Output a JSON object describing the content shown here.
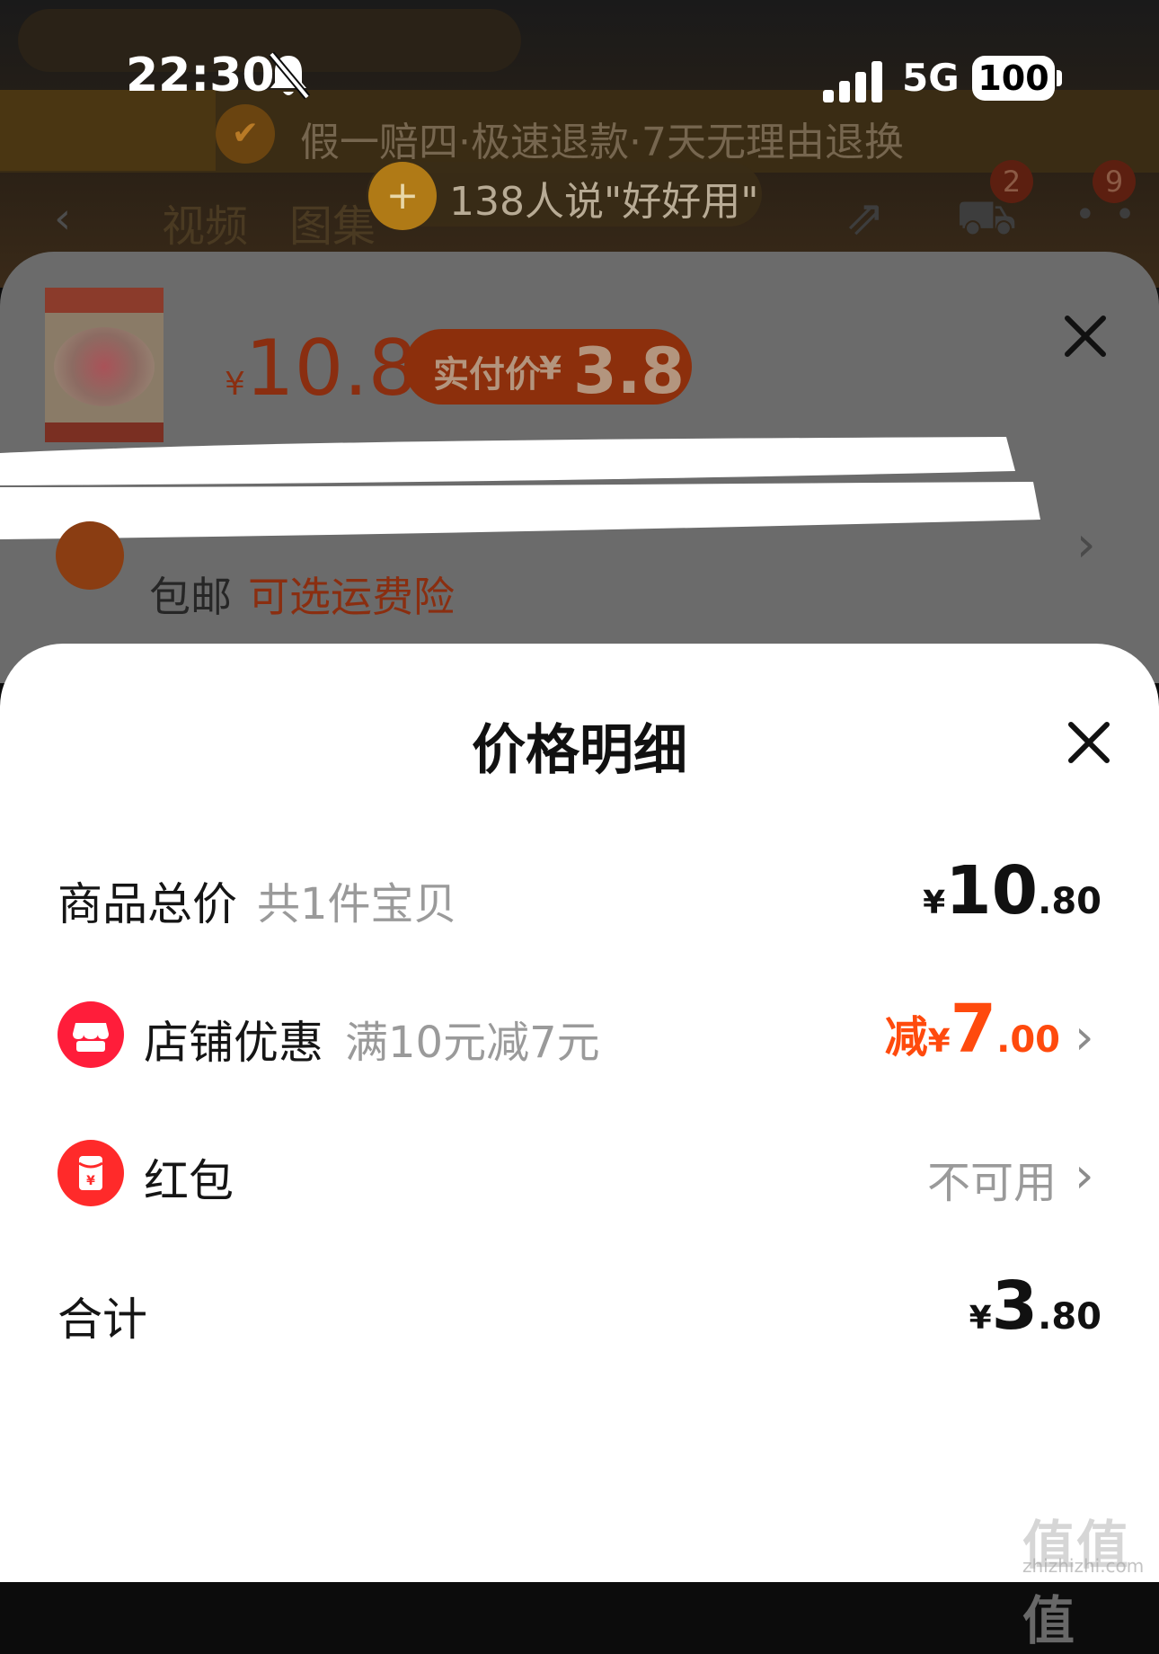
{
  "status_bar": {
    "time": "22:30",
    "network": "5G",
    "battery": "100"
  },
  "background": {
    "guarantee_text": "假一赔四·极速退款·7天无理由退换",
    "praise_text": "138人说\"好好用\"",
    "tabs": [
      "视频",
      "图集"
    ],
    "cart_badge": "2",
    "more_badge": "9"
  },
  "sku_sheet": {
    "price_currency": "¥",
    "price_value": "10.8",
    "pay_label": "实付价",
    "pay_currency": "¥",
    "pay_value": "3.8",
    "shipping_free": "包邮",
    "shipping_insurance": "可选运费险"
  },
  "price_detail": {
    "title": "价格明细",
    "rows": [
      {
        "label": "商品总价",
        "sub": "共1件宝贝",
        "currency": "¥",
        "integer": "10",
        "decimal": ".80"
      },
      {
        "label": "店铺优惠",
        "sub": "满10元减7元",
        "prefix": "减",
        "currency": "¥",
        "integer": "7",
        "decimal": ".00"
      },
      {
        "label": "红包",
        "status": "不可用"
      },
      {
        "label": "合计",
        "currency": "¥",
        "integer": "3",
        "decimal": ".80"
      }
    ]
  },
  "watermark": {
    "mark": "值值值",
    "url": "zhizhizhi.com"
  },
  "colors": {
    "accent": "#ff4a0d",
    "shop_icon": "#ff1d3a",
    "redpacket_icon": "#ff2a2a"
  },
  "icons": [
    "mute-icon",
    "signal-icon",
    "battery-icon",
    "close-icon",
    "shop-icon",
    "red-packet-icon",
    "chevron-right-icon",
    "back-icon",
    "share-icon",
    "cart-icon",
    "more-icon",
    "shield-icon"
  ]
}
